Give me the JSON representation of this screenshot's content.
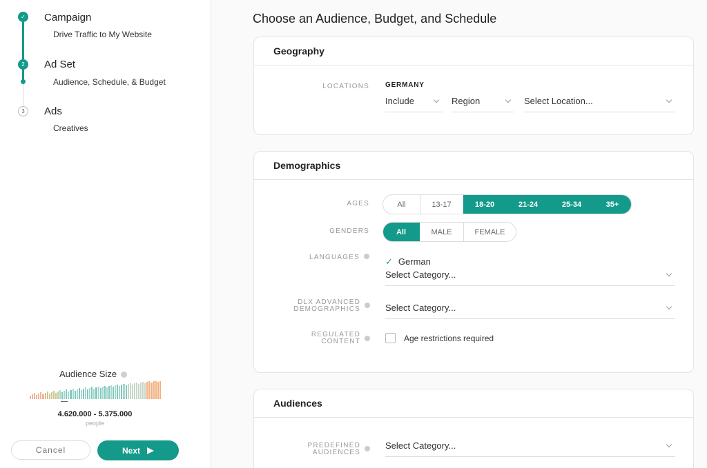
{
  "steps": [
    {
      "number": "✓",
      "title": "Campaign",
      "subtitle": "Drive Traffic to My Website"
    },
    {
      "number": "2",
      "title": "Ad Set",
      "subtitle": "Audience, Schedule, & Budget"
    },
    {
      "number": "3",
      "title": "Ads",
      "subtitle": "Creatives"
    }
  ],
  "audience": {
    "title": "Audience Size",
    "range": "4.620.000 - 5.375.000",
    "unit": "people"
  },
  "footer": {
    "cancel": "Cancel",
    "next": "Next"
  },
  "page_title": "Choose an Audience, Budget, and Schedule",
  "geography": {
    "title": "Geography",
    "locations_label": "LOCATIONS",
    "country": "GERMANY",
    "include": "Include",
    "region": "Region",
    "location_placeholder": "Select Location..."
  },
  "demographics": {
    "title": "Demographics",
    "ages_label": "AGES",
    "ages": [
      "All",
      "13-17",
      "18-20",
      "21-24",
      "25-34",
      "35+"
    ],
    "ages_selected": [
      "18-20",
      "21-24",
      "25-34",
      "35+"
    ],
    "genders_label": "GENDERS",
    "genders": [
      "All",
      "MALE",
      "FEMALE"
    ],
    "genders_selected": [
      "All"
    ],
    "languages_label": "LANGUAGES",
    "language_selected": "German",
    "language_placeholder": "Select Category...",
    "dlx_label_1": "DLX ADVANCED",
    "dlx_label_2": "DEMOGRAPHICS",
    "dlx_placeholder": "Select Category...",
    "regulated_label_1": "REGULATED",
    "regulated_label_2": "CONTENT",
    "age_restriction": "Age restrictions required"
  },
  "audiences": {
    "title": "Audiences",
    "predefined_label_1": "PREDEFINED",
    "predefined_label_2": "AUDIENCES",
    "predefined_placeholder": "Select Category..."
  },
  "colors": {
    "accent": "#139a8a"
  }
}
